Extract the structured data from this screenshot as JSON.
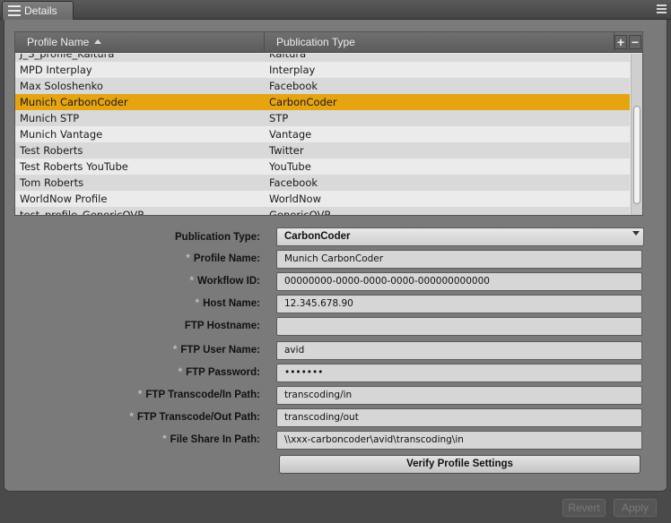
{
  "tab": {
    "label": "Details",
    "icon": "list-icon"
  },
  "table": {
    "headers": {
      "name": "Profile Name",
      "type": "Publication Type"
    },
    "add_label": "+",
    "remove_label": "−",
    "rows": [
      {
        "name": "J_S_profile_Kaltura",
        "type": "Kaltura"
      },
      {
        "name": "MPD Interplay",
        "type": "Interplay"
      },
      {
        "name": "Max Soloshenko",
        "type": "Facebook"
      },
      {
        "name": "Munich CarbonCoder",
        "type": "CarbonCoder",
        "selected": true
      },
      {
        "name": "Munich STP",
        "type": "STP"
      },
      {
        "name": "Munich Vantage",
        "type": "Vantage"
      },
      {
        "name": "Test Roberts",
        "type": "Twitter"
      },
      {
        "name": "Test Roberts YouTube",
        "type": "YouTube"
      },
      {
        "name": "Tom Roberts",
        "type": "Facebook"
      },
      {
        "name": "WorldNow Profile",
        "type": "WorldNow"
      },
      {
        "name": "test_profile_GenericOVP",
        "type": "GenericOVP"
      }
    ]
  },
  "form": {
    "publication_type": {
      "label": "Publication Type:",
      "value": "CarbonCoder"
    },
    "profile_name": {
      "label": "Profile Name:",
      "value": "Munich CarbonCoder",
      "required": true
    },
    "workflow_id": {
      "label": "Workflow ID:",
      "value": "00000000-0000-0000-0000-000000000000",
      "required": true
    },
    "host_name": {
      "label": "Host Name:",
      "value": "12.345.678.90",
      "required": true
    },
    "ftp_hostname": {
      "label": "FTP Hostname:",
      "value": "",
      "required": false
    },
    "ftp_user_name": {
      "label": "FTP User Name:",
      "value": "avid",
      "required": true
    },
    "ftp_password": {
      "label": "FTP Password:",
      "value": "•••••••",
      "required": true
    },
    "ftp_transcode_in": {
      "label": "FTP Transcode/In Path:",
      "value": "transcoding/in",
      "required": true
    },
    "ftp_transcode_out": {
      "label": "FTP Transcode/Out Path:",
      "value": "transcoding/out",
      "required": true
    },
    "file_share_in": {
      "label": "File Share In Path:",
      "value": "\\\\xxx-carboncoder\\avid\\transcoding\\in",
      "required": true
    },
    "required_marker": "*"
  },
  "buttons": {
    "verify": "Verify Profile Settings",
    "revert": "Revert",
    "apply": "Apply"
  }
}
